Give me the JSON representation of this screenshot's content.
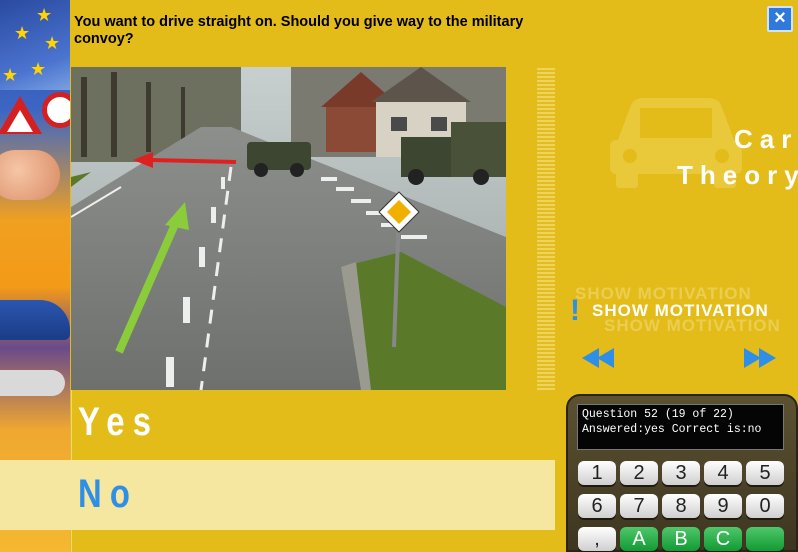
{
  "question": {
    "text": "You want to drive straight on. Should you give way to the military convoy?"
  },
  "close": {
    "label": "×",
    "icon": "close-icon"
  },
  "brand": {
    "line1": "Car",
    "line2": "Theory",
    "icon": "car-icon"
  },
  "motivation": {
    "label": "SHOW MOTIVATION",
    "ghost_label": "SHOW MOTIVATION",
    "icon": "exclamation-icon",
    "icon_glyph": "!"
  },
  "navigation": {
    "prev_icon": "rewind-icon",
    "next_icon": "fast-forward-icon"
  },
  "answers": [
    {
      "label": "Yes"
    },
    {
      "label": "No"
    }
  ],
  "display": {
    "line1": "Question 52 (19 of 22)",
    "line2": "Answered:yes Correct is:no"
  },
  "keypad": {
    "row1": [
      "1",
      "2",
      "3",
      "4",
      "5"
    ],
    "row2": [
      "6",
      "7",
      "8",
      "9",
      "0"
    ],
    "row3": [
      ",",
      "A",
      "B",
      "C",
      ""
    ]
  },
  "colors": {
    "background": "#e3bc1a",
    "accent_blue": "#2f8ee6",
    "no_answer_bg": "#f5e6a0",
    "key_green": "#129a34"
  }
}
